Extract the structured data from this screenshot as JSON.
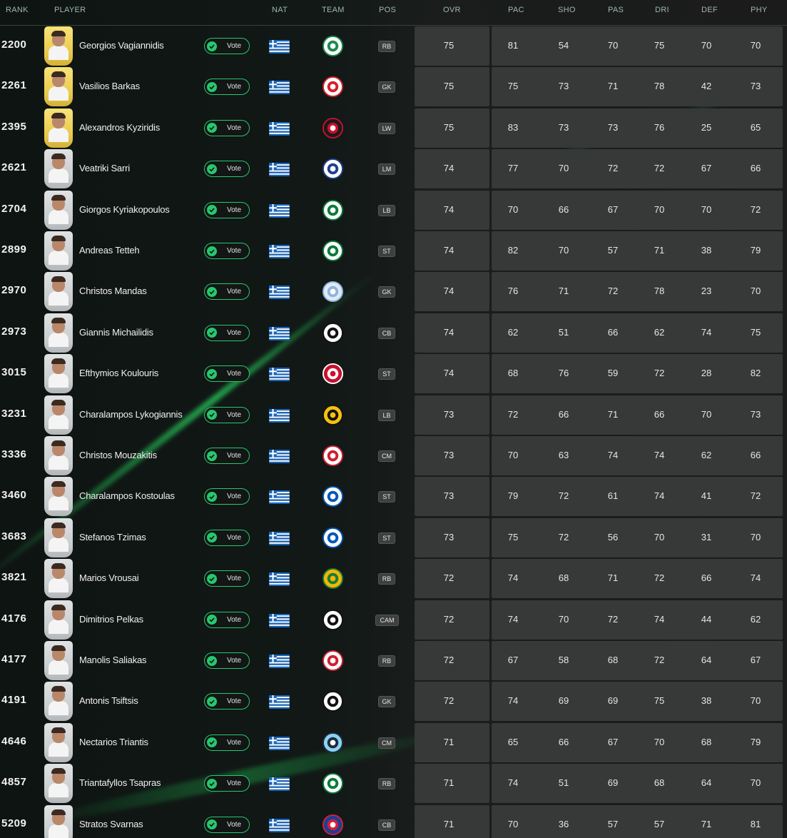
{
  "headers": {
    "rank": "RANK",
    "player": "PLAYER",
    "nat": "NAT",
    "team": "TEAM",
    "pos": "POS",
    "ovr": "OVR",
    "pac": "PAC",
    "sho": "SHO",
    "pas": "PAS",
    "dri": "DRI",
    "def": "DEF",
    "phy": "PHY"
  },
  "vote_label": "Vote",
  "colors": {
    "accent_green": "#28c76f",
    "stat_box": "#373838",
    "gold_card": "#e8c84a",
    "silver_card": "#c9ccce"
  },
  "players": [
    {
      "rank": "2200",
      "name": "Georgios Vagiannidis",
      "card": "gold",
      "club_icon": "sporting-cp-crest-icon",
      "pos": "RB",
      "ovr": "75",
      "pac": "81",
      "sho": "54",
      "pas": "70",
      "dri": "75",
      "def": "70",
      "phy": "70"
    },
    {
      "rank": "2261",
      "name": "Vasilios Barkas",
      "card": "gold",
      "club_icon": "fc-utrecht-crest-icon",
      "pos": "GK",
      "ovr": "75",
      "pac": "75",
      "sho": "73",
      "pas": "71",
      "dri": "78",
      "def": "42",
      "phy": "73"
    },
    {
      "rank": "2395",
      "name": "Alexandros Kyziridis",
      "card": "gold",
      "club_icon": "red-round-crest-icon",
      "pos": "LW",
      "ovr": "75",
      "pac": "83",
      "sho": "73",
      "pas": "73",
      "dri": "76",
      "def": "25",
      "phy": "65"
    },
    {
      "rank": "2621",
      "name": "Veatriki Sarri",
      "card": "silver",
      "club_icon": "birmingham-city-crest-icon",
      "pos": "LM",
      "ovr": "74",
      "pac": "77",
      "sho": "70",
      "pas": "72",
      "dri": "72",
      "def": "67",
      "phy": "66"
    },
    {
      "rank": "2704",
      "name": "Giorgos Kyriakopoulos",
      "card": "silver",
      "club_icon": "panathinaikos-crest-icon",
      "pos": "LB",
      "ovr": "74",
      "pac": "70",
      "sho": "66",
      "pas": "67",
      "dri": "70",
      "def": "70",
      "phy": "72"
    },
    {
      "rank": "2899",
      "name": "Andreas Tetteh",
      "card": "silver",
      "club_icon": "panathinaikos-crest-icon",
      "pos": "ST",
      "ovr": "74",
      "pac": "82",
      "sho": "70",
      "pas": "57",
      "dri": "71",
      "def": "38",
      "phy": "79"
    },
    {
      "rank": "2970",
      "name": "Christos Mandas",
      "card": "silver",
      "club_icon": "lazio-crest-icon",
      "pos": "GK",
      "ovr": "74",
      "pac": "76",
      "sho": "71",
      "pas": "72",
      "dri": "78",
      "def": "23",
      "phy": "70"
    },
    {
      "rank": "2973",
      "name": "Giannis Michailidis",
      "card": "silver",
      "club_icon": "paok-crest-icon",
      "pos": "CB",
      "ovr": "74",
      "pac": "62",
      "sho": "51",
      "pas": "66",
      "dri": "62",
      "def": "74",
      "phy": "75"
    },
    {
      "rank": "3015",
      "name": "Efthymios Koulouris",
      "card": "silver",
      "club_icon": "red-star-crest-icon",
      "pos": "ST",
      "ovr": "74",
      "pac": "68",
      "sho": "76",
      "pas": "59",
      "dri": "72",
      "def": "28",
      "phy": "82"
    },
    {
      "rank": "3231",
      "name": "Charalampos Lykogiannis",
      "card": "silver",
      "club_icon": "aek-crest-icon",
      "pos": "LB",
      "ovr": "73",
      "pac": "72",
      "sho": "66",
      "pas": "71",
      "dri": "66",
      "def": "70",
      "phy": "73"
    },
    {
      "rank": "3336",
      "name": "Christos Mouzakitis",
      "card": "silver",
      "club_icon": "olympiacos-crest-icon",
      "pos": "CM",
      "ovr": "73",
      "pac": "70",
      "sho": "63",
      "pas": "74",
      "dri": "74",
      "def": "62",
      "phy": "66"
    },
    {
      "rank": "3460",
      "name": "Charalampos Kostoulas",
      "card": "silver",
      "club_icon": "brighton-crest-icon",
      "pos": "ST",
      "ovr": "73",
      "pac": "79",
      "sho": "72",
      "pas": "61",
      "dri": "74",
      "def": "41",
      "phy": "72"
    },
    {
      "rank": "3683",
      "name": "Stefanos Tzimas",
      "card": "silver",
      "club_icon": "brighton-crest-icon",
      "pos": "ST",
      "ovr": "73",
      "pac": "75",
      "sho": "72",
      "pas": "56",
      "dri": "70",
      "def": "31",
      "phy": "70"
    },
    {
      "rank": "3821",
      "name": "Marios Vrousai",
      "card": "silver",
      "club_icon": "rio-ave-crest-icon",
      "pos": "RB",
      "ovr": "72",
      "pac": "74",
      "sho": "68",
      "pas": "71",
      "dri": "72",
      "def": "66",
      "phy": "74"
    },
    {
      "rank": "4176",
      "name": "Dimitrios Pelkas",
      "card": "silver",
      "club_icon": "paok-crest-icon",
      "pos": "CAM",
      "ovr": "72",
      "pac": "74",
      "sho": "70",
      "pas": "72",
      "dri": "74",
      "def": "44",
      "phy": "62"
    },
    {
      "rank": "4177",
      "name": "Manolis Saliakas",
      "card": "silver",
      "club_icon": "olympiacos-crest-icon",
      "pos": "RB",
      "ovr": "72",
      "pac": "67",
      "sho": "58",
      "pas": "68",
      "dri": "72",
      "def": "64",
      "phy": "67"
    },
    {
      "rank": "4191",
      "name": "Antonis Tsiftsis",
      "card": "silver",
      "club_icon": "paok-crest-icon",
      "pos": "GK",
      "ovr": "72",
      "pac": "74",
      "sho": "69",
      "pas": "69",
      "dri": "75",
      "def": "38",
      "phy": "70"
    },
    {
      "rank": "4646",
      "name": "Nectarios Triantis",
      "card": "silver",
      "club_icon": "minnesota-united-crest-icon",
      "pos": "CM",
      "ovr": "71",
      "pac": "65",
      "sho": "66",
      "pas": "67",
      "dri": "70",
      "def": "68",
      "phy": "79"
    },
    {
      "rank": "4857",
      "name": "Triantafyllos Tsapras",
      "card": "silver",
      "club_icon": "panathinaikos-crest-icon",
      "pos": "RB",
      "ovr": "71",
      "pac": "74",
      "sho": "51",
      "pas": "69",
      "dri": "68",
      "def": "64",
      "phy": "70"
    },
    {
      "rank": "5209",
      "name": "Stratos Svarnas",
      "card": "silver",
      "club_icon": "rakow-crest-icon",
      "pos": "CB",
      "ovr": "71",
      "pac": "70",
      "sho": "36",
      "pas": "57",
      "dri": "57",
      "def": "71",
      "phy": "81"
    }
  ]
}
